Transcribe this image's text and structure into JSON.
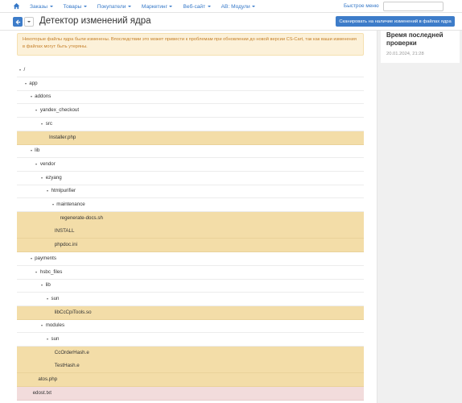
{
  "topbar": {
    "nav": [
      {
        "label": "Заказы",
        "has_caret": true
      },
      {
        "label": "Товары",
        "has_caret": true
      },
      {
        "label": "Покупатели",
        "has_caret": true
      },
      {
        "label": "Маркетинг",
        "has_caret": true
      },
      {
        "label": "Веб-сайт",
        "has_caret": true
      },
      {
        "label": "AB: Модули",
        "has_caret": true
      }
    ],
    "quick_menu": "Быстрое меню",
    "search_placeholder": ""
  },
  "header": {
    "title": "Детектор изменений ядра",
    "scan_button": "Сканировать на наличие изменений в файлах ядра"
  },
  "sidebar": {
    "title": "Время последней проверки",
    "date": "20.01.2024, 21:28"
  },
  "alert": {
    "text": "Некоторые файлы ядра были изменены. Впоследствии это может привести к проблемам при обновлении до новой версии CS-Cart, так как ваши изменения в файлах могут быть утеряны."
  },
  "tree": [
    {
      "label": "/",
      "depth": 0,
      "folder": true,
      "status": "none"
    },
    {
      "label": "app",
      "depth": 1,
      "folder": true,
      "status": "none"
    },
    {
      "label": "addons",
      "depth": 2,
      "folder": true,
      "status": "none"
    },
    {
      "label": "yandex_checkout",
      "depth": 3,
      "folder": true,
      "status": "none"
    },
    {
      "label": "src",
      "depth": 4,
      "folder": true,
      "status": "none"
    },
    {
      "label": "Installer.php",
      "depth": 5,
      "folder": false,
      "status": "changed"
    },
    {
      "label": "lib",
      "depth": 2,
      "folder": true,
      "status": "none"
    },
    {
      "label": "vendor",
      "depth": 3,
      "folder": true,
      "status": "none"
    },
    {
      "label": "ezyang",
      "depth": 4,
      "folder": true,
      "status": "none"
    },
    {
      "label": "htmlpurifier",
      "depth": 5,
      "folder": true,
      "status": "none"
    },
    {
      "label": "maintenance",
      "depth": 6,
      "folder": true,
      "status": "none"
    },
    {
      "label": "regenerate-docs.sh",
      "depth": 7,
      "folder": false,
      "status": "changed"
    },
    {
      "label": "INSTALL",
      "depth": 6,
      "folder": false,
      "status": "changed"
    },
    {
      "label": "phpdoc.ini",
      "depth": 6,
      "folder": false,
      "status": "changed"
    },
    {
      "label": "payments",
      "depth": 2,
      "folder": true,
      "status": "none"
    },
    {
      "label": "hsbc_files",
      "depth": 3,
      "folder": true,
      "status": "none"
    },
    {
      "label": "lib",
      "depth": 4,
      "folder": true,
      "status": "none"
    },
    {
      "label": "sun",
      "depth": 5,
      "folder": true,
      "status": "none"
    },
    {
      "label": "libCcCpiTools.so",
      "depth": 6,
      "folder": false,
      "status": "changed"
    },
    {
      "label": "modules",
      "depth": 4,
      "folder": true,
      "status": "none"
    },
    {
      "label": "sun",
      "depth": 5,
      "folder": true,
      "status": "none"
    },
    {
      "label": "CcOrderHash.e",
      "depth": 6,
      "folder": false,
      "status": "changed"
    },
    {
      "label": "TestHash.e",
      "depth": 6,
      "folder": false,
      "status": "changed"
    },
    {
      "label": "atos.php",
      "depth": 3,
      "folder": false,
      "status": "changed"
    },
    {
      "label": "edost.txt",
      "depth": 2,
      "folder": false,
      "status": "deleted"
    }
  ],
  "colors": {
    "accent": "#3d7cc9",
    "link": "#3578c8",
    "changed_row": "#f3dda8",
    "deleted_row": "#f2dcdc",
    "alert_bg": "#fcf1d9",
    "alert_text": "#c5802a"
  },
  "icons": {
    "home": "home-icon",
    "back": "arrow-left-icon",
    "dropdown": "chevron-down-icon",
    "tree_toggle": "caret-down-icon"
  }
}
